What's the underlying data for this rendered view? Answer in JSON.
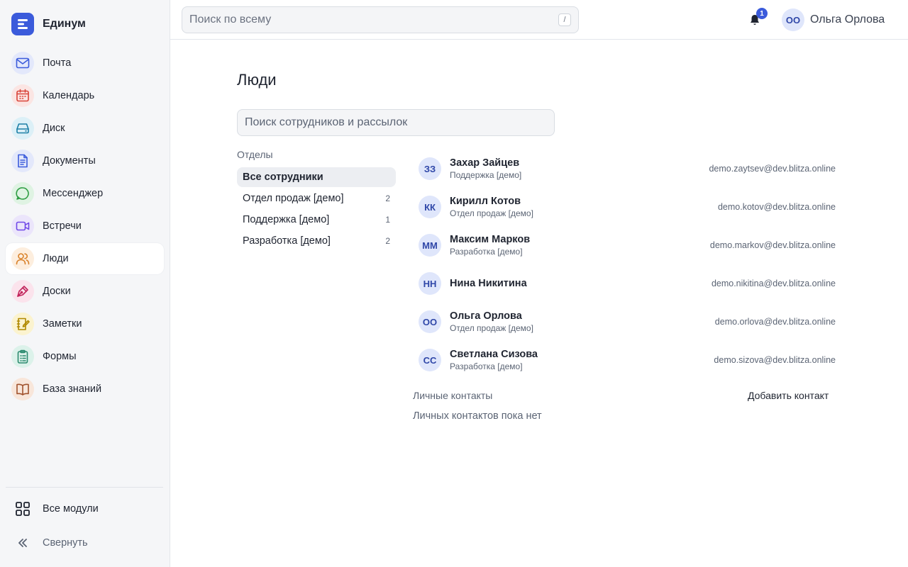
{
  "app": {
    "name": "Единум",
    "accent_color": "#3b5bdb"
  },
  "sidebar": {
    "items": [
      {
        "label": "Почта",
        "icon": "mail-icon",
        "color": "#3b5bdb",
        "bg": "#e3e8fb",
        "active": false
      },
      {
        "label": "Календарь",
        "icon": "calendar-icon",
        "color": "#d9443a",
        "bg": "#fbe5e3",
        "active": false
      },
      {
        "label": "Диск",
        "icon": "drive-icon",
        "color": "#1c7fa6",
        "bg": "#dcf0f7",
        "active": false
      },
      {
        "label": "Документы",
        "icon": "document-icon",
        "color": "#3b5bdb",
        "bg": "#e3e8fb",
        "active": false
      },
      {
        "label": "Мессенджер",
        "icon": "chat-icon",
        "color": "#2f9e44",
        "bg": "#dff3e3",
        "active": false
      },
      {
        "label": "Встречи",
        "icon": "video-icon",
        "color": "#7048e8",
        "bg": "#ebe5fb",
        "active": false
      },
      {
        "label": "Люди",
        "icon": "users-icon",
        "color": "#d9822b",
        "bg": "#fdeede",
        "active": true
      },
      {
        "label": "Доски",
        "icon": "pen-icon",
        "color": "#c2255c",
        "bg": "#fbe3ec",
        "active": false
      },
      {
        "label": "Заметки",
        "icon": "notes-icon",
        "color": "#b08900",
        "bg": "#fbf3cf",
        "active": false
      },
      {
        "label": "Формы",
        "icon": "clipboard-icon",
        "color": "#2b8a6e",
        "bg": "#dcf2ea",
        "active": false
      },
      {
        "label": "База знаний",
        "icon": "book-icon",
        "color": "#a0522d",
        "bg": "#f8e6da",
        "active": false
      }
    ],
    "all_modules": "Все модули",
    "collapse": "Свернуть"
  },
  "header": {
    "search_placeholder": "Поиск по всему",
    "search_shortcut": "/",
    "notifications_count": "1",
    "user_initials": "ОО",
    "user_name": "Ольга Орлова"
  },
  "main": {
    "title": "Люди",
    "search_placeholder": "Поиск сотрудников и рассылок",
    "departments_title": "Отделы",
    "departments": [
      {
        "label": "Все сотрудники",
        "count": "",
        "active": true
      },
      {
        "label": "Отдел продаж [демо]",
        "count": "2",
        "active": false
      },
      {
        "label": "Поддержка [демо]",
        "count": "1",
        "active": false
      },
      {
        "label": "Разработка [демо]",
        "count": "2",
        "active": false
      }
    ],
    "people": [
      {
        "initials": "ЗЗ",
        "name": "Захар Зайцев",
        "dept": "Поддержка [демо]",
        "email": "demo.zaytsev@dev.blitza.online"
      },
      {
        "initials": "КК",
        "name": "Кирилл Котов",
        "dept": "Отдел продаж [демо]",
        "email": "demo.kotov@dev.blitza.online"
      },
      {
        "initials": "ММ",
        "name": "Максим Марков",
        "dept": "Разработка [демо]",
        "email": "demo.markov@dev.blitza.online"
      },
      {
        "initials": "НН",
        "name": "Нина Никитина",
        "dept": "",
        "email": "demo.nikitina@dev.blitza.online"
      },
      {
        "initials": "ОО",
        "name": "Ольга Орлова",
        "dept": "Отдел продаж [демо]",
        "email": "demo.orlova@dev.blitza.online"
      },
      {
        "initials": "СС",
        "name": "Светлана Сизова",
        "dept": "Разработка [демо]",
        "email": "demo.sizova@dev.blitza.online"
      }
    ],
    "contacts_title": "Личные контакты",
    "add_contact": "Добавить контакт",
    "contacts_empty": "Личных контактов пока нет"
  }
}
